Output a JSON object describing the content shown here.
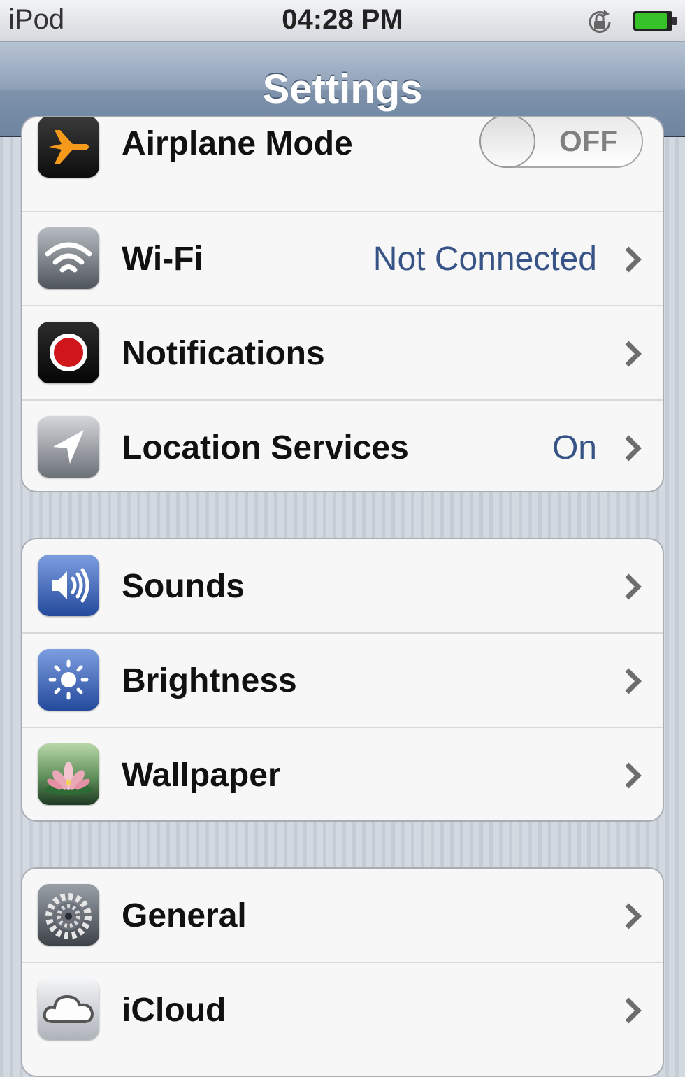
{
  "status_bar": {
    "carrier": "iPod",
    "time": "04:28 PM",
    "rotation_lock_icon": "rotation-lock-icon",
    "battery_icon": "battery-icon",
    "battery_level": 0.9,
    "battery_color": "#38c22a"
  },
  "nav": {
    "title": "Settings"
  },
  "colors": {
    "value_text": "#385487",
    "nav_bar": "#8fa1b8"
  },
  "groups": [
    {
      "rows": [
        {
          "label": "Airplane Mode",
          "icon": "airplane-icon",
          "control": "toggle",
          "toggle_state": "OFF"
        },
        {
          "label": "Wi-Fi",
          "icon": "wifi-icon",
          "value": "Not Connected",
          "accessory": "chevron"
        },
        {
          "label": "Notifications",
          "icon": "notifications-icon",
          "accessory": "chevron"
        },
        {
          "label": "Location Services",
          "icon": "location-arrow-icon",
          "value": "On",
          "accessory": "chevron"
        }
      ]
    },
    {
      "rows": [
        {
          "label": "Sounds",
          "icon": "speaker-icon",
          "accessory": "chevron"
        },
        {
          "label": "Brightness",
          "icon": "sun-icon",
          "accessory": "chevron"
        },
        {
          "label": "Wallpaper",
          "icon": "flower-icon",
          "accessory": "chevron"
        }
      ]
    },
    {
      "rows": [
        {
          "label": "General",
          "icon": "gear-icon",
          "accessory": "chevron"
        },
        {
          "label": "iCloud",
          "icon": "cloud-icon",
          "accessory": "chevron"
        }
      ]
    }
  ]
}
